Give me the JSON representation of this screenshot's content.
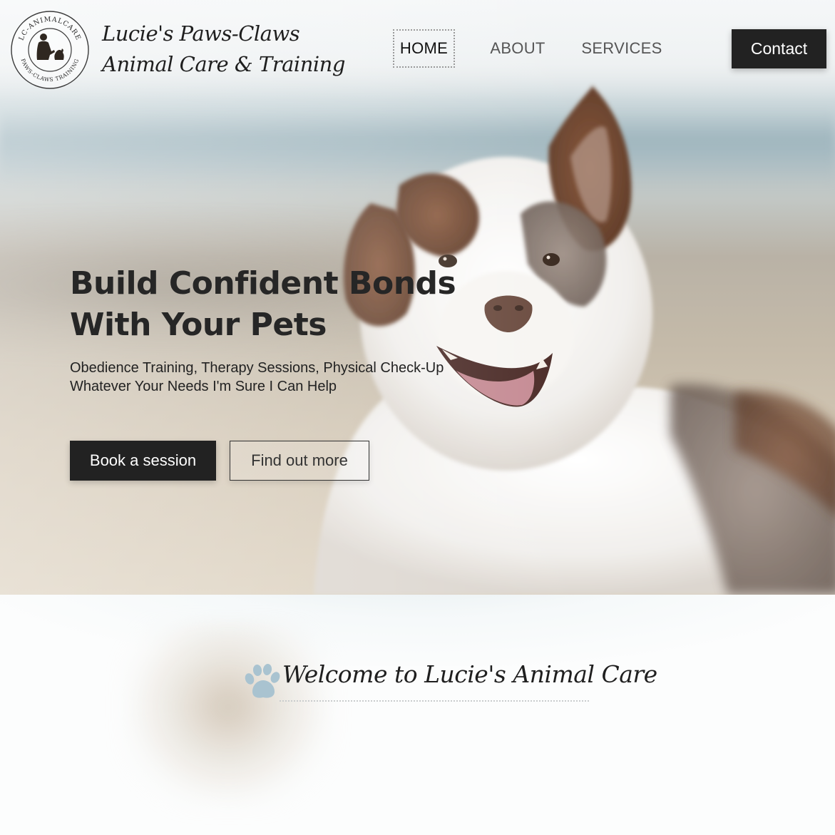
{
  "brand": {
    "logo_ring_top": "LC-ANIMALCARE",
    "logo_ring_bottom": "PAWS-CLAWS TRAINING",
    "name_line1": "Lucie's Paws-Claws",
    "name_line2": "Animal Care & Training"
  },
  "nav": {
    "items": [
      {
        "label": "HOME",
        "active": true
      },
      {
        "label": "ABOUT",
        "active": false
      },
      {
        "label": "SERVICES",
        "active": false
      }
    ],
    "contact_label": "Contact"
  },
  "hero": {
    "title_line1": "Build Confident Bonds",
    "title_line2": "With Your Pets",
    "subtitle_line1": "Obedience Training, Therapy Sessions, Physical Check-Up",
    "subtitle_line2": "Whatever Your Needs I'm Sure I Can Help",
    "primary_button": "Book a session",
    "secondary_button": "Find out more",
    "image": "dog-photo"
  },
  "welcome": {
    "icon": "paw-icon",
    "title": "Welcome to Lucie's Animal Care"
  },
  "colors": {
    "dark_button": "#222222",
    "text": "#222222",
    "paw_accent": "#a9c3d0",
    "nav_inactive": "#555555"
  }
}
